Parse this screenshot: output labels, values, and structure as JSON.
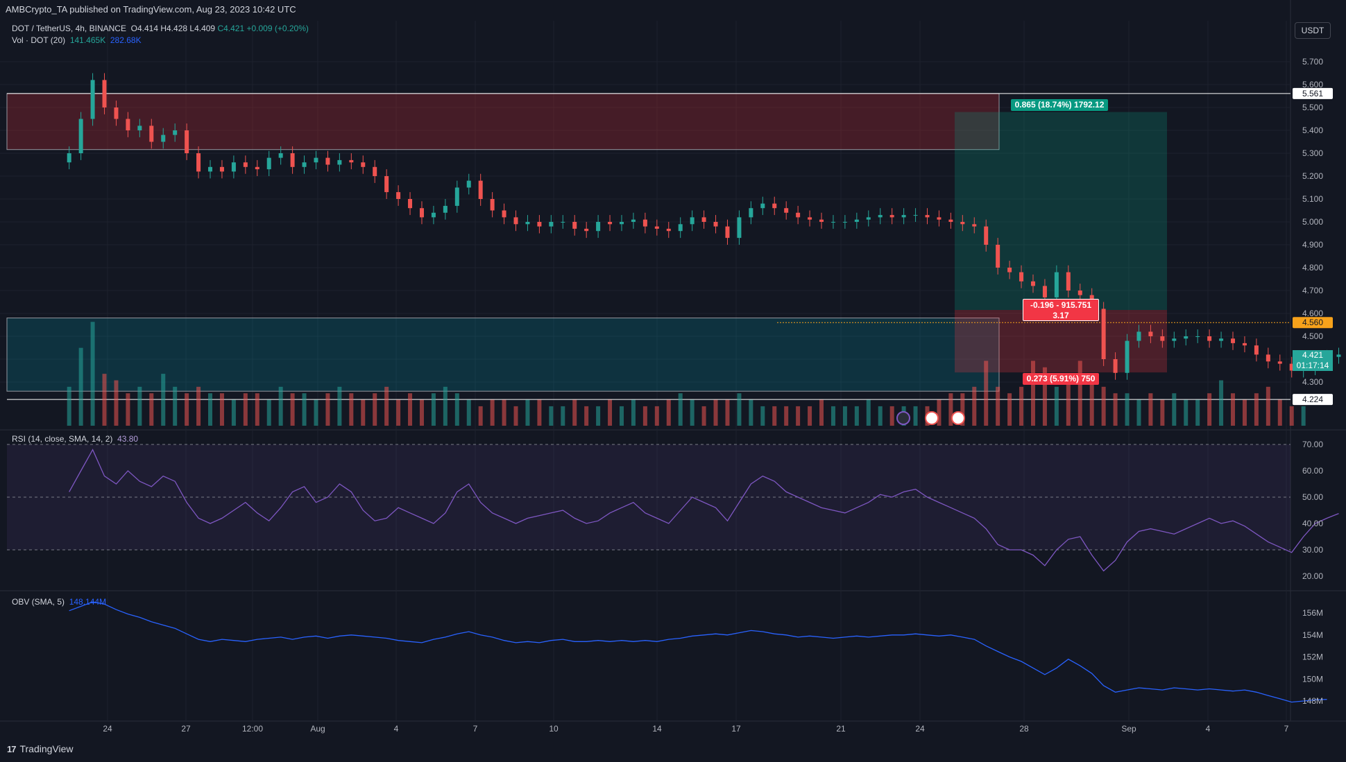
{
  "header": {
    "publisher": "AMBCrypto_TA published on TradingView.com, Aug 23, 2023 10:42 UTC",
    "symbol": "DOT / TetherUS, 4h, BINANCE",
    "ohlc": {
      "o": "O4.414",
      "h": "H4.428",
      "l": "L4.409",
      "c": "C4.421",
      "chg": "+0.009 (+0.20%)"
    },
    "vol_label": "Vol · DOT (20)",
    "vol_value": "141.465K",
    "vol_ma": "282.68K",
    "rsi_label": "RSI (14, close, SMA, 14, 2)",
    "rsi_value": "43.80",
    "obv_label": "OBV (SMA, 5)",
    "obv_value": "148.144M"
  },
  "currency": "USDT",
  "footer_brand": "TradingView",
  "price_axis": {
    "ticks": [
      "5.700",
      "5.600",
      "5.500",
      "5.400",
      "5.300",
      "5.200",
      "5.100",
      "5.000",
      "4.900",
      "4.800",
      "4.700",
      "4.600",
      "4.500",
      "4.400",
      "4.300"
    ],
    "marked": [
      {
        "label": "5.561",
        "price": 5.561,
        "bg": "#ffffff",
        "fg": "#131722"
      },
      {
        "label": "4.560",
        "price": 4.56,
        "bg": "#f7a21b",
        "fg": "#131722"
      },
      {
        "label": "4.224",
        "price": 4.224,
        "bg": "#ffffff",
        "fg": "#131722"
      }
    ],
    "last_price": "4.421",
    "countdown": "01:17:14",
    "last_color": "#26a69a"
  },
  "rsi_axis": {
    "ticks": [
      "70.00",
      "60.00",
      "50.00",
      "40.00",
      "30.00",
      "20.00"
    ]
  },
  "obv_axis": {
    "ticks": [
      "156M",
      "154M",
      "152M",
      "150M",
      "148M"
    ]
  },
  "time_axis": {
    "ticks": [
      "24",
      "27",
      "12:00",
      "Aug",
      "4",
      "7",
      "10",
      "14",
      "17",
      "21",
      "24",
      "28",
      "Sep",
      "4",
      "7"
    ]
  },
  "position_tool": {
    "target_label": "0.865 (18.74%) 1792.12",
    "entry_label_1": "-0.196 - 915.751",
    "entry_label_2": "3.17",
    "stop_label": "0.273 (5.91%) 750"
  },
  "chart_data": [
    {
      "type": "candlestick",
      "title": "DOT / TetherUS, 4h, BINANCE",
      "x_range": [
        "Jul 22 2023",
        "Sep 7 2023"
      ],
      "ylim": [
        4.2,
        5.75
      ],
      "key_levels": {
        "resistance_zone": [
          5.316,
          5.561
        ],
        "support_zone": [
          4.26,
          4.58
        ],
        "support_line": 4.224
      },
      "close_series": [
        5.3,
        5.45,
        5.62,
        5.5,
        5.45,
        5.4,
        5.42,
        5.35,
        5.38,
        5.4,
        5.3,
        5.22,
        5.24,
        5.22,
        5.26,
        5.24,
        5.23,
        5.28,
        5.3,
        5.24,
        5.26,
        5.28,
        5.25,
        5.27,
        5.26,
        5.24,
        5.2,
        5.13,
        5.1,
        5.06,
        5.02,
        5.04,
        5.07,
        5.15,
        5.18,
        5.1,
        5.05,
        5.02,
        4.99,
        5.0,
        4.98,
        5.0,
        5.0,
        4.97,
        4.96,
        5.0,
        4.99,
        5.0,
        5.01,
        4.98,
        4.97,
        4.96,
        4.99,
        5.02,
        5.0,
        4.98,
        4.93,
        5.02,
        5.06,
        5.08,
        5.06,
        5.04,
        5.02,
        5.01,
        5.0,
        5.0,
        5.0,
        5.01,
        5.02,
        5.03,
        5.02,
        5.03,
        5.03,
        5.02,
        5.01,
        5.0,
        4.99,
        4.98,
        4.9,
        4.8,
        4.78,
        4.74,
        4.72,
        4.67,
        4.78,
        4.7,
        4.68,
        4.62,
        4.4,
        4.34,
        4.48,
        4.52,
        4.5,
        4.48,
        4.49,
        4.5,
        4.5,
        4.48,
        4.49,
        4.47,
        4.46,
        4.42,
        4.39,
        4.38,
        4.35,
        4.36,
        4.38,
        4.41,
        4.42
      ],
      "volume_series": [
        0.6,
        1.2,
        1.6,
        0.8,
        0.7,
        0.5,
        0.6,
        0.5,
        0.8,
        0.6,
        0.5,
        0.6,
        0.5,
        0.5,
        0.4,
        0.5,
        0.5,
        0.4,
        0.6,
        0.5,
        0.5,
        0.4,
        0.5,
        0.6,
        0.5,
        0.4,
        0.5,
        0.6,
        0.4,
        0.5,
        0.4,
        0.5,
        0.6,
        0.5,
        0.4,
        0.3,
        0.4,
        0.4,
        0.3,
        0.4,
        0.4,
        0.3,
        0.3,
        0.4,
        0.3,
        0.3,
        0.4,
        0.3,
        0.4,
        0.3,
        0.3,
        0.4,
        0.5,
        0.4,
        0.3,
        0.4,
        0.4,
        0.5,
        0.4,
        0.3,
        0.3,
        0.3,
        0.3,
        0.3,
        0.4,
        0.3,
        0.3,
        0.3,
        0.4,
        0.3,
        0.3,
        0.3,
        0.3,
        0.3,
        0.4,
        0.5,
        0.5,
        0.6,
        1.0,
        0.6,
        0.5,
        0.6,
        1.0,
        0.9,
        0.6,
        0.7,
        1.0,
        0.8,
        0.6,
        0.5,
        0.5,
        0.4,
        0.5,
        0.4,
        0.5,
        0.4,
        0.4,
        0.5,
        0.7,
        0.5,
        0.4,
        0.5,
        0.6,
        0.4,
        0.3,
        0.3
      ]
    },
    {
      "type": "line",
      "title": "RSI (14, close, SMA, 14, 2)",
      "ylim": [
        17,
        72
      ],
      "bands": [
        30,
        50,
        70
      ],
      "values": [
        52,
        60,
        68,
        58,
        55,
        60,
        56,
        54,
        58,
        56,
        48,
        42,
        40,
        42,
        45,
        48,
        44,
        41,
        46,
        52,
        54,
        48,
        50,
        55,
        52,
        45,
        41,
        42,
        46,
        44,
        42,
        40,
        44,
        52,
        55,
        48,
        44,
        42,
        40,
        42,
        43,
        44,
        45,
        42,
        40,
        41,
        44,
        46,
        48,
        44,
        42,
        40,
        45,
        50,
        48,
        46,
        41,
        48,
        55,
        58,
        56,
        52,
        50,
        48,
        46,
        45,
        44,
        46,
        48,
        51,
        50,
        52,
        53,
        50,
        48,
        46,
        44,
        42,
        38,
        32,
        30,
        30,
        28,
        24,
        30,
        34,
        35,
        28,
        22,
        26,
        33,
        37,
        38,
        37,
        36,
        38,
        40,
        42,
        40,
        41,
        39,
        36,
        33,
        31,
        29,
        35,
        40,
        42,
        43.8
      ]
    },
    {
      "type": "line",
      "title": "OBV (SMA, 5)",
      "ylim": [
        147,
        157.5
      ],
      "values": [
        156.2,
        156.6,
        157.0,
        156.8,
        156.3,
        155.9,
        155.6,
        155.2,
        154.9,
        154.6,
        154.1,
        153.6,
        153.4,
        153.6,
        153.5,
        153.4,
        153.6,
        153.7,
        153.8,
        153.6,
        153.8,
        153.9,
        153.7,
        153.9,
        154.0,
        153.9,
        153.8,
        153.7,
        153.5,
        153.4,
        153.3,
        153.6,
        153.8,
        154.1,
        154.3,
        154.0,
        153.8,
        153.5,
        153.3,
        153.4,
        153.3,
        153.5,
        153.6,
        153.4,
        153.4,
        153.5,
        153.4,
        153.5,
        153.4,
        153.5,
        153.4,
        153.6,
        153.7,
        153.9,
        154.0,
        154.1,
        154.0,
        154.2,
        154.4,
        154.3,
        154.1,
        154.0,
        153.8,
        153.9,
        153.8,
        153.7,
        153.8,
        153.9,
        153.8,
        153.9,
        154.0,
        154.0,
        154.1,
        154.0,
        153.9,
        154.0,
        153.8,
        153.6,
        153.0,
        152.5,
        152.0,
        151.6,
        151.0,
        150.4,
        151.0,
        151.8,
        151.2,
        150.5,
        149.4,
        148.8,
        149.0,
        149.2,
        149.1,
        149.0,
        149.2,
        149.1,
        149.0,
        149.1,
        149.0,
        148.9,
        149.0,
        148.8,
        148.5,
        148.2,
        147.9,
        148.0,
        148.1,
        148.144
      ]
    }
  ]
}
